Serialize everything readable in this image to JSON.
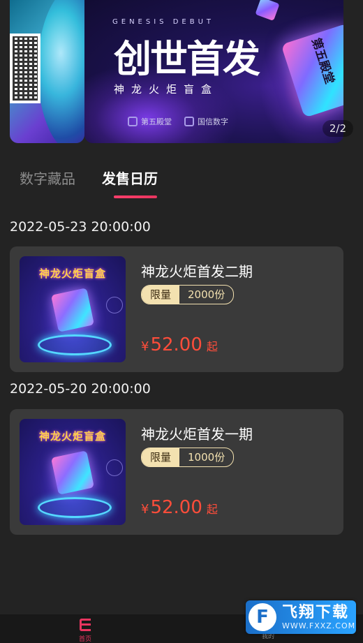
{
  "banner": {
    "genesis_label": "GENESIS DEBUT",
    "title": "创世首发",
    "subtitle": "神龙火炬盲盒",
    "cube_text": "第五殿堂",
    "logos": [
      "第五殿堂",
      "国信数字"
    ],
    "page_indicator": "2/2"
  },
  "tabs": [
    {
      "label": "数字藏品",
      "active": false
    },
    {
      "label": "发售日历",
      "active": true
    }
  ],
  "accent_color": "#e8355f",
  "price_color": "#ff4d3a",
  "releases": [
    {
      "date": "2022-05-23 20:00:00",
      "thumb_title": "神龙火炬盲盒",
      "title": "神龙火炬首发二期",
      "badge_label": "限量",
      "badge_value": "2000份",
      "currency": "¥",
      "price": "52.00",
      "price_suffix": "起"
    },
    {
      "date": "2022-05-20 20:00:00",
      "thumb_title": "神龙火炬盲盒",
      "title": "神龙火炬首发一期",
      "badge_label": "限量",
      "badge_value": "1000份",
      "currency": "¥",
      "price": "52.00",
      "price_suffix": "起"
    }
  ],
  "bottom_nav": [
    {
      "label": "首页",
      "icon": "home-icon",
      "active": true
    },
    {
      "label": "我的",
      "icon": "profile-icon",
      "active": false
    }
  ],
  "watermark": {
    "logo_glyph": "F",
    "text": "飞翔下载",
    "url": "WWW.FXXZ.COM"
  }
}
